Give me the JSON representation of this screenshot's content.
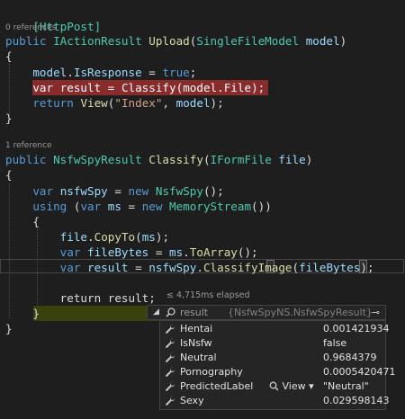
{
  "code": {
    "attribute": "[HttpPost]",
    "upload_refs": "0 references",
    "classify_refs": "1 reference",
    "l1": {
      "kw": "public",
      "type": "IActionResult",
      "method": "Upload",
      "p1": "(",
      "ptype": "SingleFileModel",
      "pname": "model",
      "p2": ")"
    },
    "brace_open": "{",
    "brace_close": "}",
    "l3": {
      "v": "model",
      "p1": ".",
      "prop": "IsResponse",
      "p2": " = ",
      "kw": "true",
      "p3": ";"
    },
    "l4": {
      "kw": "var",
      "v": "result",
      "p1": " = ",
      "m": "Classify",
      "p2": "(",
      "v2": "model",
      "p3": ".",
      "prop": "File",
      "p4": ");"
    },
    "l5": {
      "kw": "return",
      "m": "View",
      "p1": "(",
      "s": "\"Index\"",
      "p2": ", ",
      "v": "model",
      "p3": ");"
    },
    "l8": {
      "kw": "public",
      "type": "NsfwSpyResult",
      "method": "Classify",
      "p1": "(",
      "ptype": "IFormFile",
      "pname": "file",
      "p2": ")"
    },
    "l10": {
      "kw": "var",
      "v": "nsfwSpy",
      "p1": " = ",
      "kw2": "new",
      "type": "NsfwSpy",
      "p2": "();"
    },
    "l11": {
      "kw": "using",
      "p1": " (",
      "kw2": "var",
      "v": "ms",
      "p2": " = ",
      "kw3": "new",
      "type": "MemoryStream",
      "p3": "())"
    },
    "l13": {
      "v": "file",
      "p1": ".",
      "m": "CopyTo",
      "p2": "(",
      "v2": "ms",
      "p3": ");"
    },
    "l14": {
      "kw": "var",
      "v": "fileBytes",
      "p1": " = ",
      "v2": "ms",
      "p2": ".",
      "m": "ToArray",
      "p3": "();"
    },
    "l15": {
      "kw": "var",
      "v": "result",
      "p1": " = ",
      "v2": "nsfwSpy",
      "p2": ".",
      "m": "ClassifyImage",
      "p3": "(",
      "v3": "fileBytes",
      "p4": ");"
    },
    "l17": {
      "kw": "return",
      "v": "result",
      "p1": ";"
    }
  },
  "perf_tip": "≤ 4,715ms elapsed",
  "datatip": {
    "name": "result",
    "type": "{NsfwSpyNS.NsfwSpyResult}",
    "pin": "⊸",
    "view_label": "View",
    "properties": [
      {
        "name": "Hentai",
        "value": "0.001421934"
      },
      {
        "name": "IsNsfw",
        "value": "false"
      },
      {
        "name": "Neutral",
        "value": "0.9684379"
      },
      {
        "name": "Pornography",
        "value": "0.0005420471"
      },
      {
        "name": "PredictedLabel",
        "value": "\"Neutral\""
      },
      {
        "name": "Sexy",
        "value": "0.029598143"
      }
    ]
  },
  "colors": {
    "background": "#1e1e1e",
    "keyword": "#569cd6",
    "type": "#4ec9b0",
    "method": "#dcdcaa",
    "variable": "#9cdcfe",
    "string": "#d69d85",
    "breakpoint_line": "#8a2b2b",
    "current_statement": "#535f00"
  }
}
